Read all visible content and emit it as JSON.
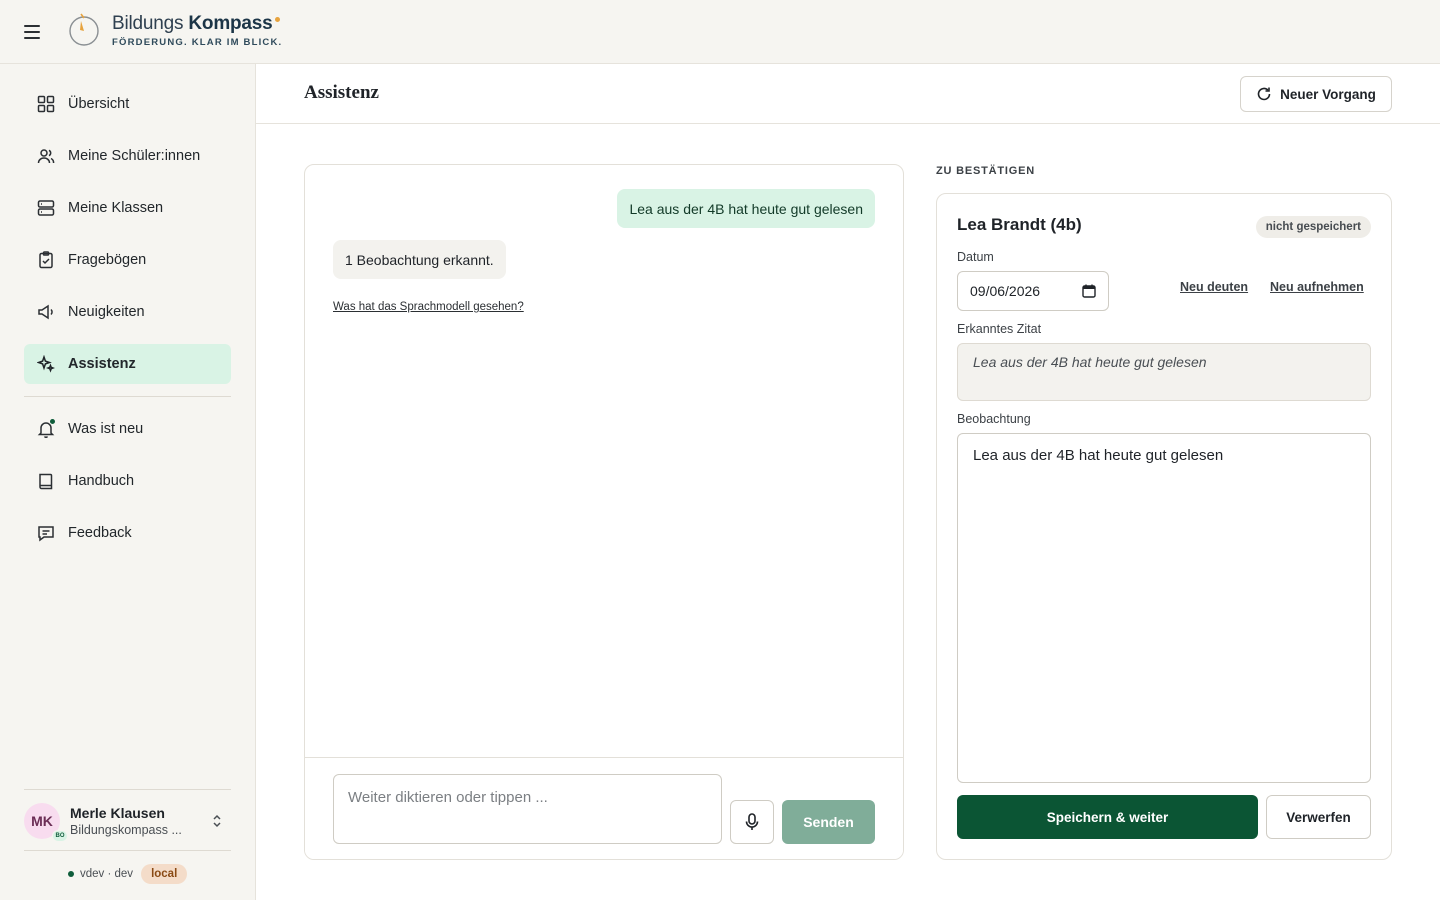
{
  "app": {
    "brand_name_light": "Bildungs",
    "brand_name_bold": "Kompass",
    "tagline": "FÖRDERUNG. KLAR IM BLICK."
  },
  "sidebar": {
    "items": [
      {
        "label": "Übersicht",
        "icon": "grid-icon"
      },
      {
        "label": "Meine Schüler:innen",
        "icon": "users-icon"
      },
      {
        "label": "Meine Klassen",
        "icon": "stack-icon"
      },
      {
        "label": "Fragebögen",
        "icon": "clipboard-icon"
      },
      {
        "label": "Neuigkeiten",
        "icon": "megaphone-icon"
      },
      {
        "label": "Assistenz",
        "icon": "sparkles-icon",
        "active": true
      }
    ],
    "secondary": [
      {
        "label": "Was ist neu",
        "icon": "bell-icon"
      },
      {
        "label": "Handbuch",
        "icon": "book-icon"
      },
      {
        "label": "Feedback",
        "icon": "message-icon"
      }
    ],
    "user": {
      "initials": "MK",
      "badge": "BO",
      "name": "Merle Klausen",
      "org": "Bildungskompass ..."
    },
    "version": {
      "text": "vdev · dev",
      "env": "local"
    }
  },
  "header": {
    "title": "Assistenz",
    "new_button": "Neuer Vorgang"
  },
  "chat": {
    "user_message": "Lea aus der 4B hat heute gut gelesen",
    "bot_message": "1 Beobachtung erkannt.",
    "llm_link": "Was hat das Sprachmodell gesehen?",
    "input_placeholder": "Weiter diktieren oder tippen ...",
    "input_value": "",
    "send_label": "Senden"
  },
  "confirm": {
    "section_label": "ZU BESTÄTIGEN",
    "student": "Lea Brandt (4b)",
    "status": "nicht gespeichert",
    "date_label": "Datum",
    "date_value": "09/06/2026",
    "reinterpret_label": "Neu deuten",
    "rerecord_label": "Neu aufnehmen",
    "quote_label": "Erkanntes Zitat",
    "quote_value": "Lea aus der 4B hat heute gut gelesen",
    "observation_label": "Beobachtung",
    "observation_value": "Lea aus der 4B hat heute gut gelesen",
    "save_label": "Speichern & weiter",
    "discard_label": "Verwerfen"
  },
  "colors": {
    "brand_green": "#0b5534",
    "active_bg": "#d9f3e5",
    "accent_orange": "#e7a33e",
    "sidebar_bg": "#f6f5f1"
  }
}
